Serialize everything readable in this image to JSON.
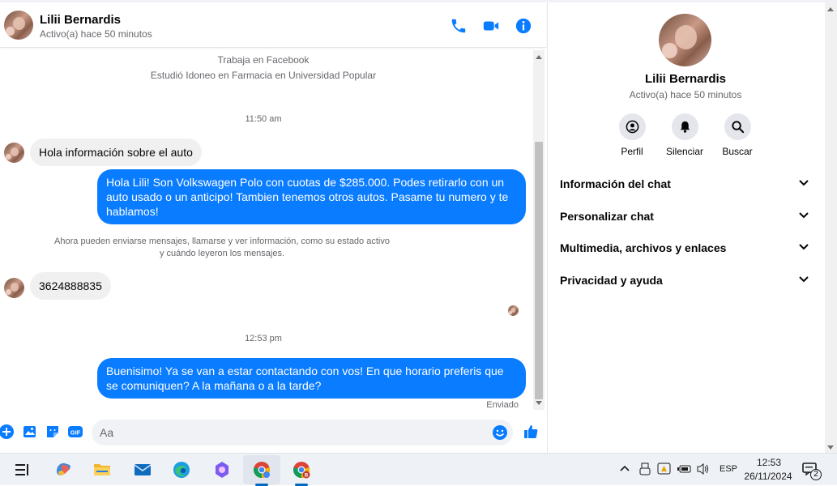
{
  "contact": {
    "name": "Lilii Bernardis",
    "status": "Activo(a) hace 50 minutos"
  },
  "intro": {
    "work": "Trabaja en Facebook",
    "study": "Estudió Idoneo en Farmacia en Universidad Popular"
  },
  "messages": {
    "ts1": "11:50 am",
    "m1": "Hola información sobre el auto",
    "m2": "Hola Lili! Son Volkswagen Polo con cuotas de $285.000. Podes retirarlo con un auto usado o un anticipo! Tambien tenemos otros autos. Pasame tu numero y te hablamos!",
    "system_line1": "Ahora pueden enviarse mensajes, llamarse y ver información, como su estado activo",
    "system_line2": "y cuándo leyeron los mensajes.",
    "m3": "3624888835",
    "ts2": "12:53 pm",
    "m4": "Buenisimo! Ya se van a estar contactando con vos! En que horario preferis que se comuniquen? A la mañana o a la tarde?",
    "sent_label": "Enviado"
  },
  "composer": {
    "placeholder": "Aa"
  },
  "info_panel": {
    "actions": [
      {
        "label": "Perfil",
        "icon": "profile-icon"
      },
      {
        "label": "Silenciar",
        "icon": "bell-icon"
      },
      {
        "label": "Buscar",
        "icon": "search-icon"
      }
    ],
    "sections": [
      "Información del chat",
      "Personalizar chat",
      "Multimedia, archivos y enlaces",
      "Privacidad y ayuda"
    ]
  },
  "taskbar": {
    "language": "ESP",
    "time": "12:53",
    "date": "26/11/2024",
    "notification_count": "2"
  },
  "colors": {
    "accent": "#0a7cff",
    "incoming_bubble": "#f0f0f0",
    "secondary_text": "#65676b"
  }
}
